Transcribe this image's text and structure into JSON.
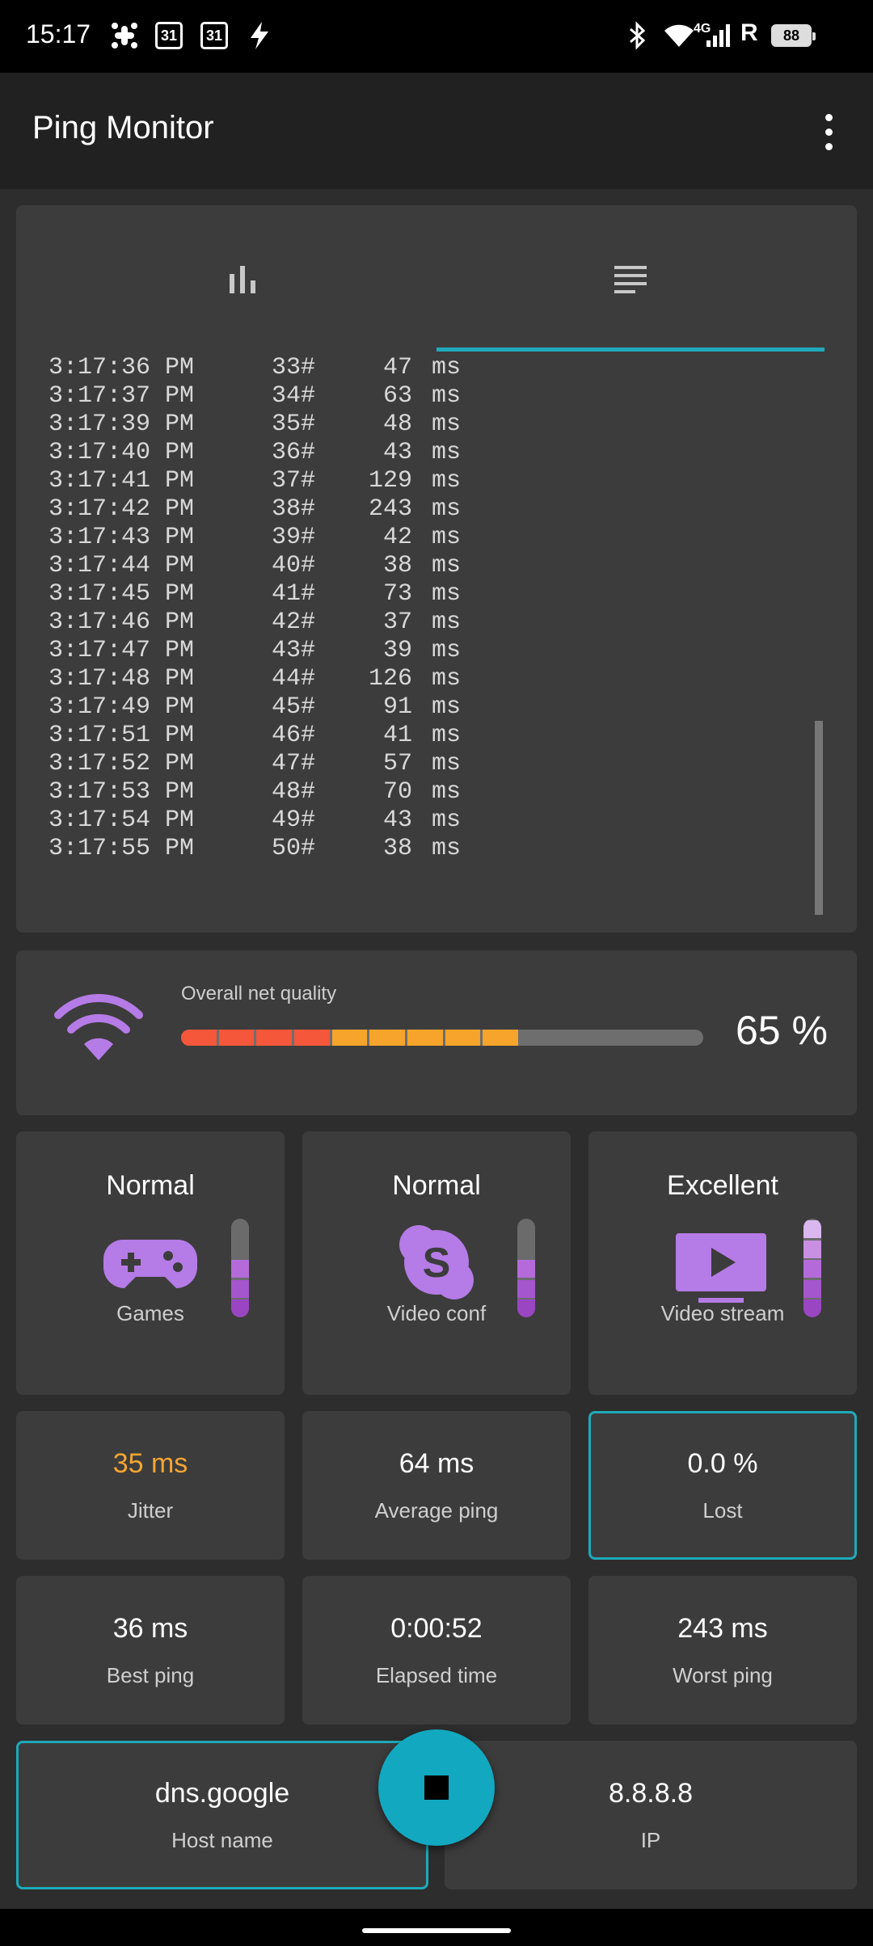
{
  "status_bar": {
    "time": "15:17",
    "calendar_1": "31",
    "calendar_2": "31",
    "network": "4G",
    "roaming": "R",
    "battery": "88"
  },
  "app_bar": {
    "title": "Ping Monitor"
  },
  "tabs": [
    {
      "icon": "bar-chart-icon",
      "selected": false
    },
    {
      "icon": "list-icon",
      "selected": true
    }
  ],
  "log": [
    {
      "time": "3:17:36 PM",
      "seq": "33#",
      "value": "47",
      "unit": "ms"
    },
    {
      "time": "3:17:37 PM",
      "seq": "34#",
      "value": "63",
      "unit": "ms"
    },
    {
      "time": "3:17:39 PM",
      "seq": "35#",
      "value": "48",
      "unit": "ms"
    },
    {
      "time": "3:17:40 PM",
      "seq": "36#",
      "value": "43",
      "unit": "ms"
    },
    {
      "time": "3:17:41 PM",
      "seq": "37#",
      "value": "129",
      "unit": "ms"
    },
    {
      "time": "3:17:42 PM",
      "seq": "38#",
      "value": "243",
      "unit": "ms"
    },
    {
      "time": "3:17:43 PM",
      "seq": "39#",
      "value": "42",
      "unit": "ms"
    },
    {
      "time": "3:17:44 PM",
      "seq": "40#",
      "value": "38",
      "unit": "ms"
    },
    {
      "time": "3:17:45 PM",
      "seq": "41#",
      "value": "73",
      "unit": "ms"
    },
    {
      "time": "3:17:46 PM",
      "seq": "42#",
      "value": "37",
      "unit": "ms"
    },
    {
      "time": "3:17:47 PM",
      "seq": "43#",
      "value": "39",
      "unit": "ms"
    },
    {
      "time": "3:17:48 PM",
      "seq": "44#",
      "value": "126",
      "unit": "ms"
    },
    {
      "time": "3:17:49 PM",
      "seq": "45#",
      "value": "91",
      "unit": "ms"
    },
    {
      "time": "3:17:51 PM",
      "seq": "46#",
      "value": "41",
      "unit": "ms"
    },
    {
      "time": "3:17:52 PM",
      "seq": "47#",
      "value": "57",
      "unit": "ms"
    },
    {
      "time": "3:17:53 PM",
      "seq": "48#",
      "value": "70",
      "unit": "ms"
    },
    {
      "time": "3:17:54 PM",
      "seq": "49#",
      "value": "43",
      "unit": "ms"
    },
    {
      "time": "3:17:55 PM",
      "seq": "50#",
      "value": "38",
      "unit": "ms"
    }
  ],
  "quality": {
    "label": "Overall net quality",
    "value": "65 %",
    "fraction": 0.65,
    "colors": {
      "low": "#f4573a",
      "mid": "#f6a42b",
      "track": "#6e6e6e"
    }
  },
  "categories": [
    {
      "rating": "Normal",
      "label": "Games",
      "icon": "gamepad-icon",
      "level": 0.55
    },
    {
      "rating": "Normal",
      "label": "Video conf",
      "icon": "skype-icon",
      "level": 0.55
    },
    {
      "rating": "Excellent",
      "label": "Video stream",
      "icon": "video-play-icon",
      "level": 1.0
    }
  ],
  "stats": {
    "jitter": {
      "value": "35 ms",
      "label": "Jitter",
      "color": "#f5a531"
    },
    "average": {
      "value": "64 ms",
      "label": "Average ping"
    },
    "lost": {
      "value": "0.0 %",
      "label": "Lost"
    },
    "best": {
      "value": "36 ms",
      "label": "Best ping"
    },
    "elapsed": {
      "value": "0:00:52",
      "label": "Elapsed time"
    },
    "worst": {
      "value": "243 ms",
      "label": "Worst ping"
    }
  },
  "host": {
    "value": "dns.google",
    "label": "Host name"
  },
  "ip": {
    "value": "8.8.8.8",
    "label": "IP"
  },
  "fab": {
    "icon": "stop-icon"
  },
  "accent_color": "#1eaab9",
  "icon_color": "#b57be6"
}
